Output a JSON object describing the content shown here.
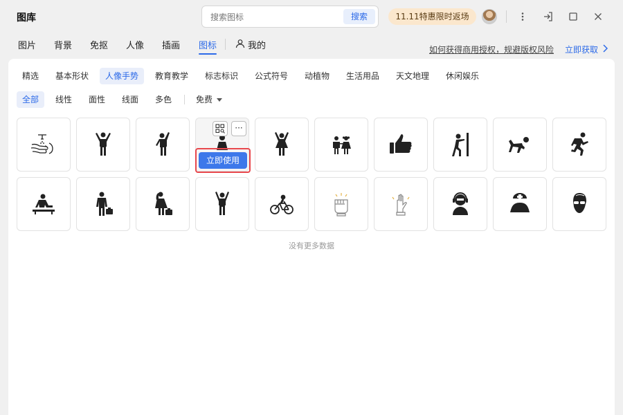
{
  "app": {
    "title": "图库"
  },
  "search": {
    "placeholder": "搜索图标",
    "button_label": "搜索"
  },
  "promo": {
    "label": "11.11特惠限时返场",
    "color": "#fbe7cd"
  },
  "window_icons": [
    "more-vertical-icon",
    "exit-icon",
    "maximize-icon",
    "close-icon"
  ],
  "nav": {
    "tabs": [
      {
        "label": "图片"
      },
      {
        "label": "背景"
      },
      {
        "label": "免抠"
      },
      {
        "label": "人像"
      },
      {
        "label": "插画"
      },
      {
        "label": "图标",
        "active": true
      }
    ],
    "mine_label": "我的",
    "license_link": "如何获得商用授权，规避版权风险",
    "get_link": "立即获取",
    "accent": "#2c6ae8"
  },
  "categories": [
    {
      "label": "精选"
    },
    {
      "label": "基本形状"
    },
    {
      "label": "人像手势",
      "active": true
    },
    {
      "label": "教育教学"
    },
    {
      "label": "标志标识"
    },
    {
      "label": "公式符号"
    },
    {
      "label": "动植物"
    },
    {
      "label": "生活用品"
    },
    {
      "label": "天文地理"
    },
    {
      "label": "休闲娱乐"
    }
  ],
  "filters": {
    "styles": [
      {
        "label": "全部",
        "active": true
      },
      {
        "label": "线性"
      },
      {
        "label": "面性"
      },
      {
        "label": "线面"
      },
      {
        "label": "多色"
      }
    ],
    "price_label": "免费"
  },
  "grid": {
    "rows": [
      [
        "wash-hands-icon",
        "person-arms-up-icon",
        "person-waving-icon",
        "girl-icon",
        "woman-arms-up-icon",
        "boy-and-girl-icon",
        "thumbs-up-icon",
        "person-pushing-wall-icon",
        "person-crawling-icon",
        "person-running-icon"
      ],
      [
        "person-at-desk-icon",
        "businessman-icon",
        "businesswoman-icon",
        "person-cheering-icon",
        "cyclist-icon",
        "fist-icon",
        "raised-hand-icon",
        "customer-service-icon",
        "nurse-icon",
        "man-sunglasses-icon"
      ]
    ],
    "hover_index": 3,
    "use_button_label": "立即使用",
    "more_button_label": "···",
    "empty_message": "没有更多数据"
  }
}
